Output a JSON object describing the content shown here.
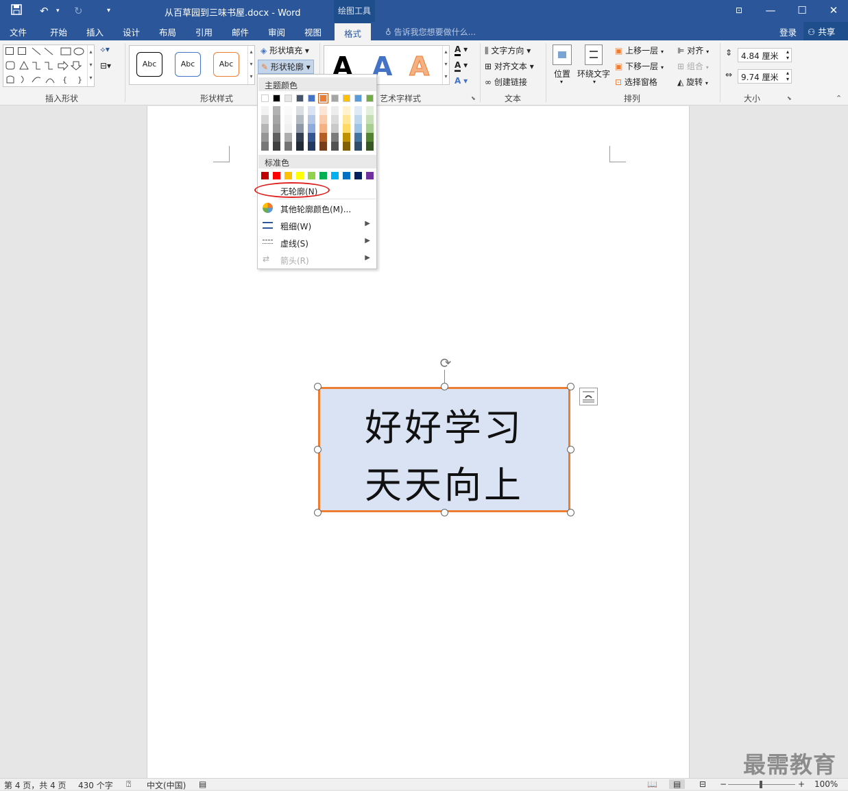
{
  "title_bar": {
    "title": "从百草园到三味书屋.docx - Word",
    "context_tool": "绘图工具",
    "save_icon": "save-icon",
    "undo_icon": "undo-icon",
    "redo_icon": "redo-icon"
  },
  "tabs": [
    "文件",
    "开始",
    "插入",
    "设计",
    "布局",
    "引用",
    "邮件",
    "审阅",
    "视图",
    "格式"
  ],
  "active_tab": "格式",
  "tell_me": "告诉我您想要做什么...",
  "account": {
    "login": "登录",
    "share": "共享"
  },
  "ribbon": {
    "groups": [
      "插入形状",
      "形状样式",
      "艺术字样式",
      "文本",
      "排列",
      "大小"
    ],
    "shape_style_samples": [
      "Abc",
      "Abc",
      "Abc"
    ],
    "shape_fill": "形状填充",
    "shape_outline": "形状轮廓",
    "art_letters": [
      "A",
      "A",
      "A"
    ],
    "text_group": {
      "direction": "文字方向",
      "align": "对齐文本",
      "link": "创建链接"
    },
    "arrange": {
      "position": "位置",
      "wrap": "环绕文字",
      "forward": "上移一层",
      "backward": "下移一层",
      "pane": "选择窗格",
      "align": "对齐",
      "group": "组合",
      "rotate": "旋转"
    },
    "size": {
      "height": "4.84 厘米",
      "width": "9.74 厘米"
    }
  },
  "outline_menu": {
    "theme_header": "主题颜色",
    "standard_header": "标准色",
    "theme_top_row": [
      "#ffffff",
      "#000000",
      "#e7e6e6",
      "#44546a",
      "#4472c4",
      "#ed7d31",
      "#a5a5a5",
      "#ffc000",
      "#5b9bd5",
      "#70ad47"
    ],
    "standard_colors": [
      "#c00000",
      "#ff0000",
      "#ffc000",
      "#ffff00",
      "#92d050",
      "#00b050",
      "#00b0f0",
      "#0070c0",
      "#002060",
      "#7030a0"
    ],
    "no_outline": "无轮廓(N)",
    "more_colors": "其他轮廓颜色(M)...",
    "weight": "粗细(W)",
    "dashes": "虚线(S)",
    "arrows": "箭头(R)"
  },
  "document": {
    "line1": "好好学习",
    "line2": "天天向上"
  },
  "status_bar": {
    "page": "第 4 页，共 4 页",
    "words": "430 个字",
    "language": "中文(中国)",
    "zoom": "100%"
  },
  "watermark": "最需教育"
}
